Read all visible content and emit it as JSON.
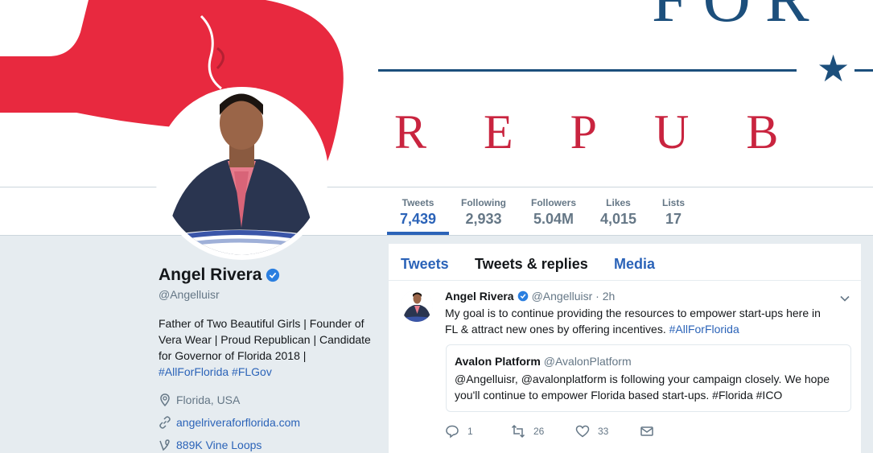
{
  "banner": {
    "top_text": "FOR",
    "bottom_text": "REPUB",
    "colors": {
      "red": "#e8293f",
      "navy": "#1c4f7c",
      "crimson": "#c9243f"
    }
  },
  "stats": [
    {
      "label": "Tweets",
      "value": "7,439",
      "active": true
    },
    {
      "label": "Following",
      "value": "2,933",
      "active": false
    },
    {
      "label": "Followers",
      "value": "5.04M",
      "active": false
    },
    {
      "label": "Likes",
      "value": "4,015",
      "active": false
    },
    {
      "label": "Lists",
      "value": "17",
      "active": false
    }
  ],
  "profile": {
    "name": "Angel Rivera",
    "handle": "@Angelluisr",
    "bio_lines": [
      "Father of Two Beautiful Girls | Founder of",
      "Vera Wear | Proud Republican | Candidate",
      "for Governor of Florida 2018 |"
    ],
    "bio_tags": "#AllForFlorida #FLGov",
    "location": "Florida, USA",
    "website": "angelriveraforflorida.com",
    "vine": "889K Vine Loops",
    "icons": {
      "location": "location-pin-icon",
      "website": "link-icon",
      "vine": "vine-icon",
      "verified": "verified-badge-icon"
    }
  },
  "timeline": {
    "tabs": [
      {
        "label": "Tweets",
        "style": "blue"
      },
      {
        "label": "Tweets & replies",
        "style": "black"
      },
      {
        "label": "Media",
        "style": "blue"
      }
    ],
    "tweet": {
      "name": "Angel Rivera",
      "handle_time": "@Angelluisr · 2h",
      "text_line1": "My goal is to continue providing the resources to empower start-ups here in",
      "text_line2": "FL & attract new ones by offering incentives. ",
      "text_tag": "#AllForFlorida",
      "quote": {
        "name": "Avalon Platform",
        "handle": "@AvalonPlatform",
        "text_line1": "@Angelluisr, @avalonplatform is following your campaign closely. We hope",
        "text_line2": "you'll continue to empower Florida based start-ups. #Florida #ICO"
      },
      "actions": {
        "replies": "1",
        "retweets": "26",
        "likes": "33"
      }
    }
  },
  "accent_color": "#2b63b8"
}
